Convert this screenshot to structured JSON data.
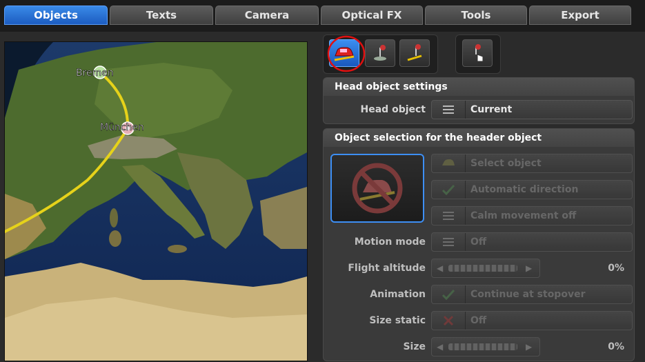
{
  "tabs": [
    "Objects",
    "Texts",
    "Camera",
    "Optical FX",
    "Tools",
    "Export"
  ],
  "map": {
    "city1": "Bremen",
    "city2": "München"
  },
  "head_settings": {
    "title": "Head object settings",
    "label": "Head object",
    "value": "Current"
  },
  "selection": {
    "title": "Object selection for the header object",
    "select_object": "Select object",
    "automatic_direction": "Automatic direction",
    "calm_movement": "Calm movement off",
    "motion_mode_label": "Motion mode",
    "motion_mode_value": "Off",
    "flight_altitude_label": "Flight altitude",
    "flight_altitude_value": "0%",
    "animation_label": "Animation",
    "animation_value": "Continue at stopover",
    "size_static_label": "Size static",
    "size_static_value": "Off",
    "size_label": "Size",
    "size_value": "0%"
  },
  "colors": {
    "accent": "#2a74e0",
    "highlight_circle": "#e01010",
    "route": "#e6d21a"
  }
}
